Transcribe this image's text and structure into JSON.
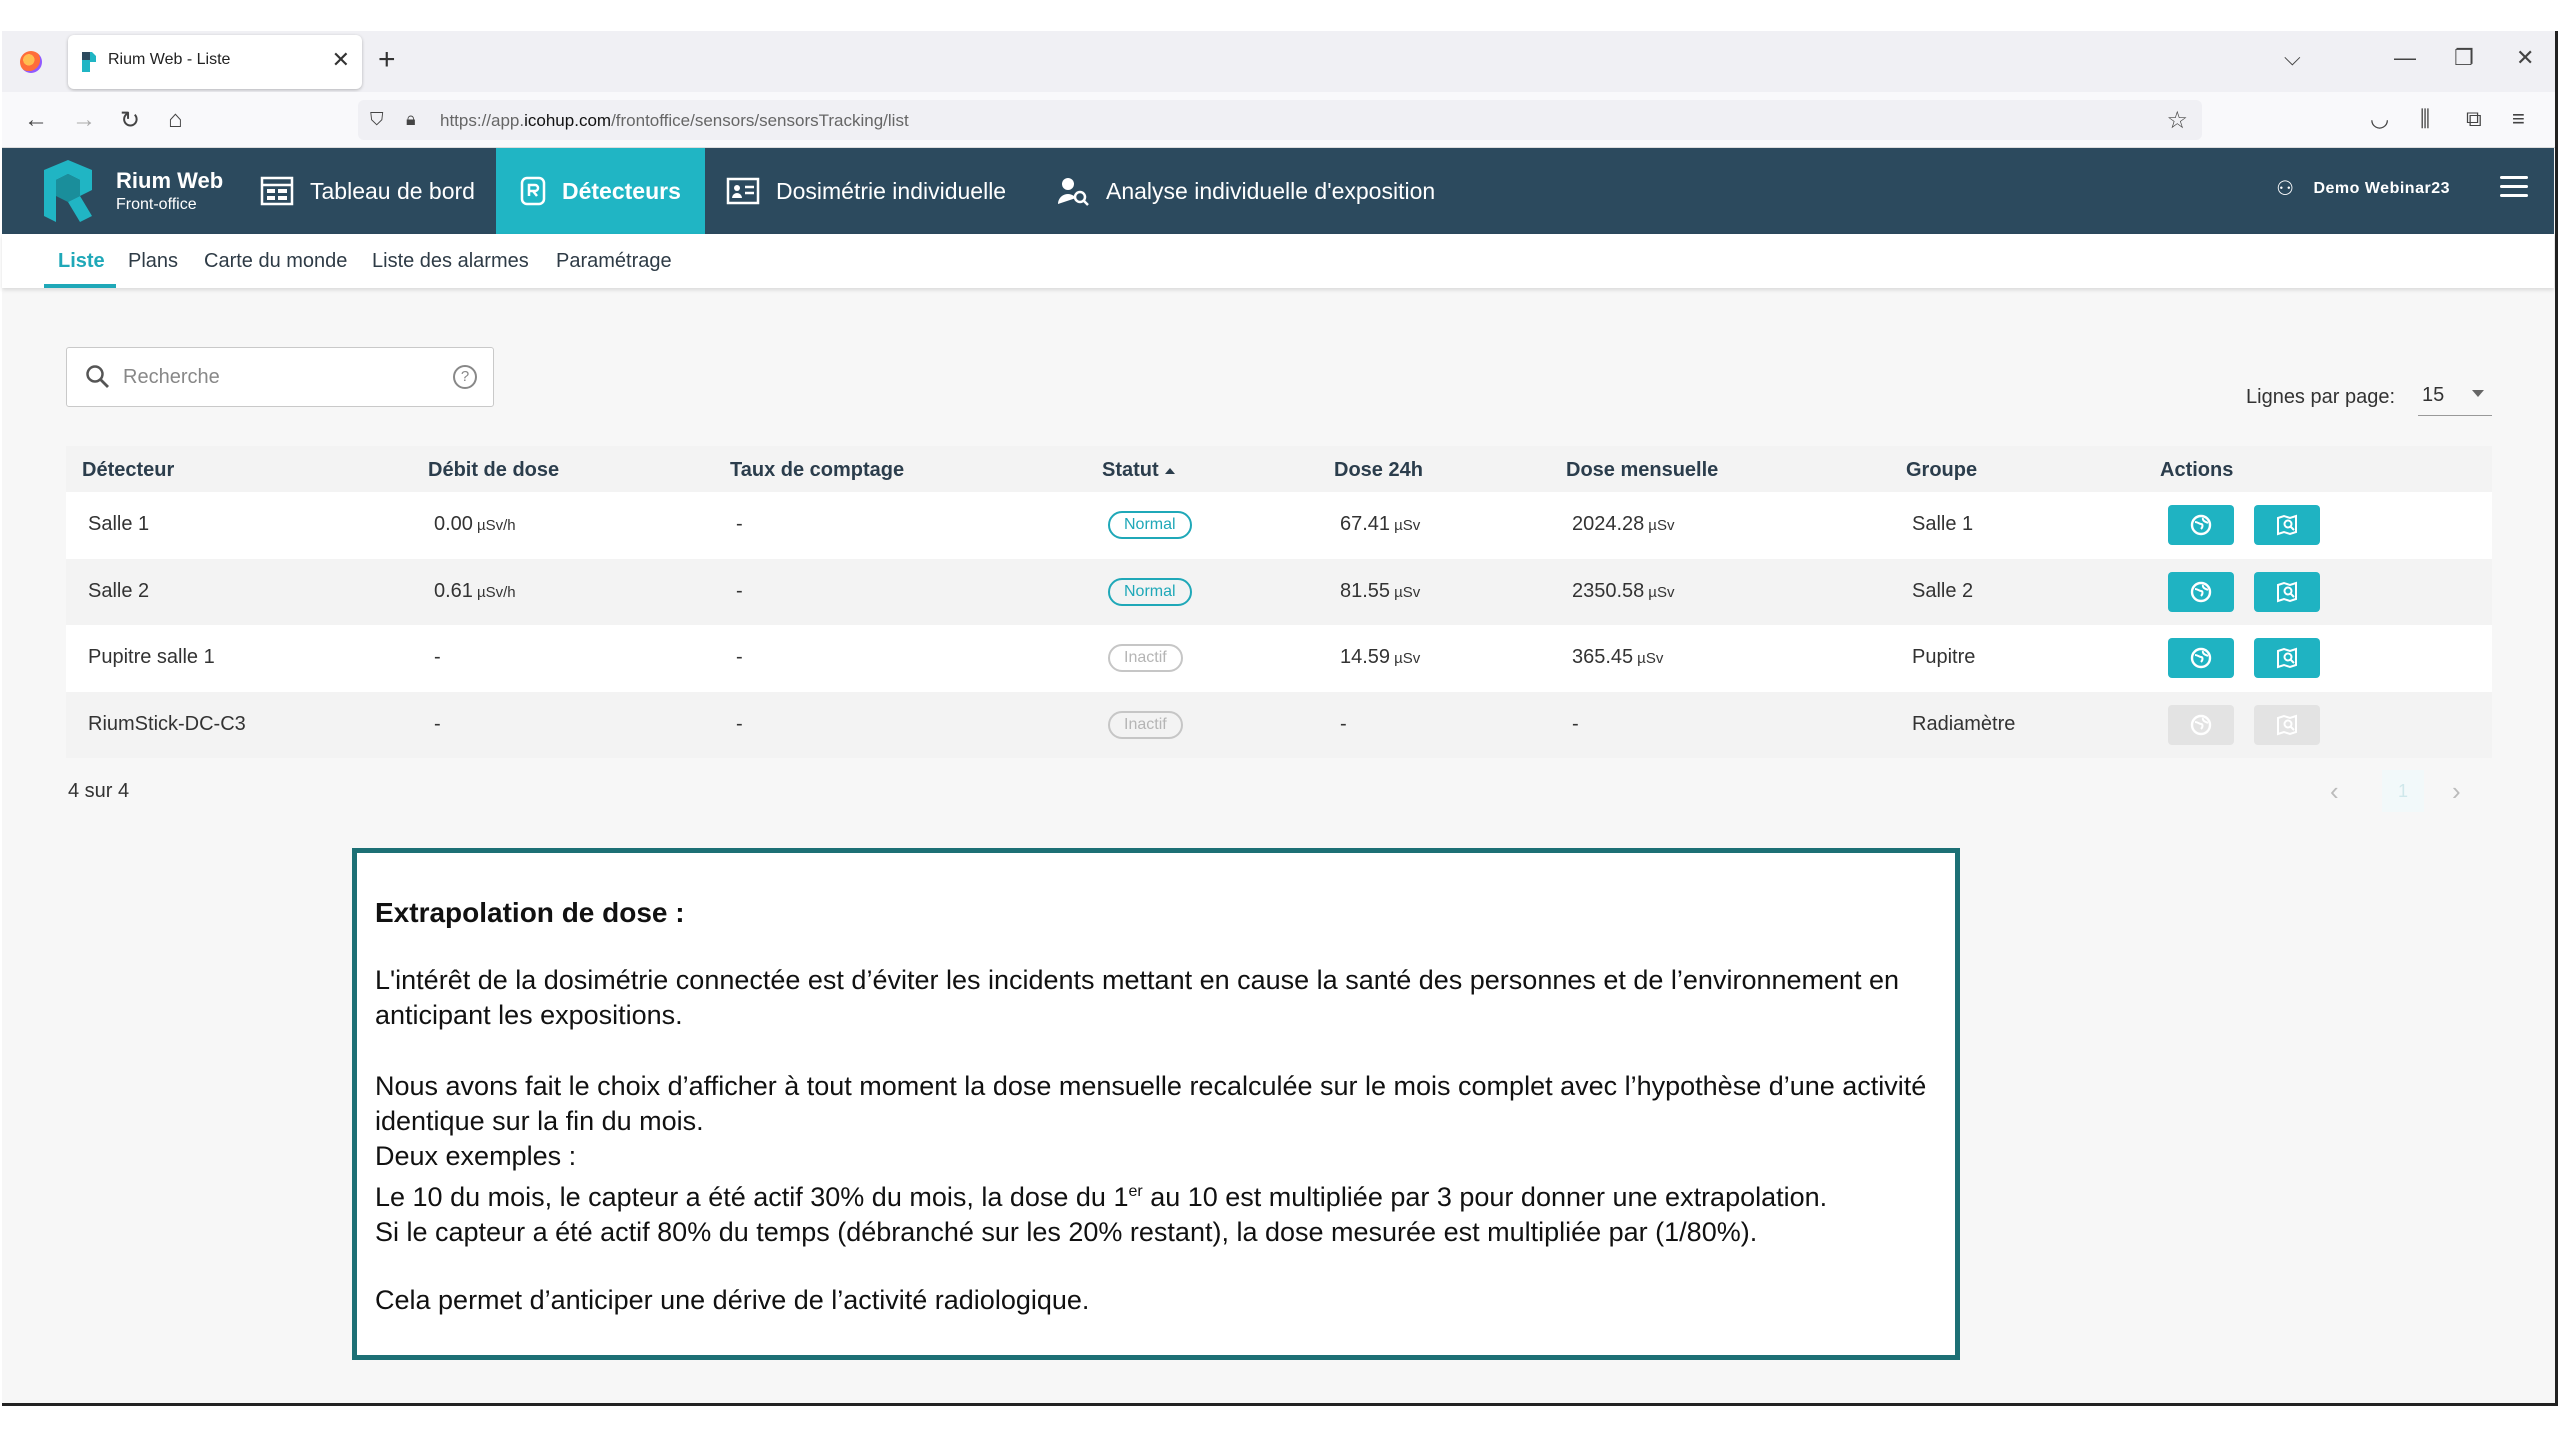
{
  "browser": {
    "tab_title": "Rium Web - Liste",
    "tab_close": "✕",
    "new_tab": "+",
    "url_prefix": "https://app.",
    "url_domain": "icohup.com",
    "url_path": "/frontoffice/sensors/sensorsTracking/list"
  },
  "app": {
    "brand_title": "Rium Web",
    "brand_subtitle": "Front-office",
    "menu": [
      {
        "label": "Tableau de bord",
        "icon": "dashboard-icon"
      },
      {
        "label": "Détecteurs",
        "icon": "detector-icon",
        "active": true
      },
      {
        "label": "Dosimétrie individuelle",
        "icon": "id-card-icon"
      },
      {
        "label": "Analyse individuelle d'exposition",
        "icon": "user-search-icon"
      }
    ],
    "user_name": "Demo Webinar23",
    "accent_color": "#20b5c4",
    "header_color": "#2c4a5e"
  },
  "subnav": {
    "tabs": [
      {
        "label": "Liste",
        "active": true
      },
      {
        "label": "Plans"
      },
      {
        "label": "Carte du monde"
      },
      {
        "label": "Liste des alarmes"
      },
      {
        "label": "Paramétrage"
      }
    ]
  },
  "search": {
    "placeholder": "Recherche",
    "help": "?"
  },
  "rows_per_page": {
    "label": "Lignes par page:",
    "value": "15"
  },
  "table": {
    "columns": [
      "Détecteur",
      "Débit de dose",
      "Taux de comptage",
      "Statut",
      "Dose 24h",
      "Dose mensuelle",
      "Groupe",
      "Actions"
    ],
    "rows": [
      {
        "detector": "Salle 1",
        "dose_rate": "0.00",
        "dose_rate_unit": "µSv/h",
        "count_rate": "-",
        "status": "Normal",
        "status_type": "normal",
        "dose24": "67.41",
        "dose24_unit": "µSv",
        "dose_month": "2024.28",
        "dose_month_unit": "µSv",
        "group": "Salle 1",
        "actions_enabled": true
      },
      {
        "detector": "Salle 2",
        "dose_rate": "0.61",
        "dose_rate_unit": "µSv/h",
        "count_rate": "-",
        "status": "Normal",
        "status_type": "normal",
        "dose24": "81.55",
        "dose24_unit": "µSv",
        "dose_month": "2350.58",
        "dose_month_unit": "µSv",
        "group": "Salle 2",
        "actions_enabled": true
      },
      {
        "detector": "Pupitre salle 1",
        "dose_rate": "-",
        "dose_rate_unit": "",
        "count_rate": "-",
        "status": "Inactif",
        "status_type": "inactive",
        "dose24": "14.59",
        "dose24_unit": "µSv",
        "dose_month": "365.45",
        "dose_month_unit": "µSv",
        "group": "Pupitre",
        "actions_enabled": true
      },
      {
        "detector": "RiumStick-DC-C3",
        "dose_rate": "-",
        "dose_rate_unit": "",
        "count_rate": "-",
        "status": "Inactif",
        "status_type": "inactive",
        "dose24": "-",
        "dose24_unit": "",
        "dose_month": "-",
        "dose_month_unit": "",
        "group": "Radiamètre",
        "actions_enabled": false
      }
    ],
    "count_text": "4 sur 4"
  },
  "pagination": {
    "prev": "‹",
    "page": "1",
    "next": "›"
  },
  "note": {
    "title": "Extrapolation de dose :",
    "p1": "L'intérêt de la dosimétrie connectée est d’éviter les incidents mettant en cause la santé des personnes et de l’environnement en anticipant les expositions.",
    "p2_line1": "Nous avons fait le choix d’afficher à tout moment la dose mensuelle recalculée sur le mois complet avec l’hypothèse d’une activité identique sur la fin du mois.",
    "p2_line2": "Deux exemples :",
    "p2_line3_a": "Le 10 du mois, le capteur a été actif 30% du mois, la dose du 1",
    "p2_line3_sup": "er",
    "p2_line3_b": " au 10 est multipliée par 3 pour donner une extrapolation.",
    "p2_line4": "Si le capteur a été actif 80% du temps (débranché sur les 20% restant), la dose mesurée est multipliée par (1/80%).",
    "p3": "Cela permet d’anticiper une dérive de l’activité radiologique."
  }
}
